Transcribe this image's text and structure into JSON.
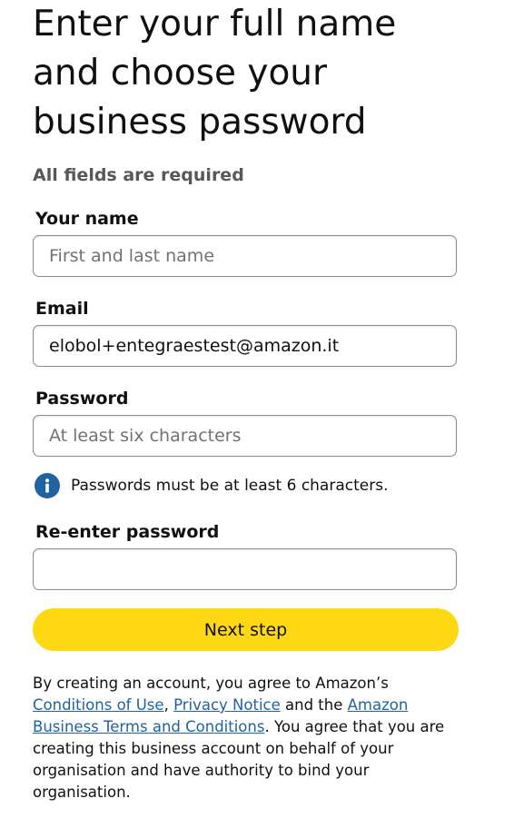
{
  "heading": {
    "line1": "Enter your full name",
    "line2": "and choose your",
    "line3": "business password"
  },
  "subtitle": "All fields are required",
  "fields": {
    "name": {
      "label": "Your name",
      "placeholder": "First and last name",
      "value": ""
    },
    "email": {
      "label": "Email",
      "placeholder": "",
      "value": "elobol+entegraestest@amazon.it"
    },
    "password": {
      "label": "Password",
      "placeholder": "At least six characters",
      "value": ""
    },
    "reenter": {
      "label": "Re-enter password",
      "placeholder": "",
      "value": ""
    }
  },
  "hint": {
    "icon": "info-icon",
    "text": "Passwords must be at least 6 characters."
  },
  "next_button": "Next step",
  "legal": {
    "intro": "By creating an account, you agree to Amazon’s",
    "conditions_link": "Conditions of Use",
    "comma": ",",
    "privacy_link": "Privacy Notice",
    "and_the": "and the",
    "terms_link": "Amazon Business Terms and Conditions",
    "outro": ". You agree that you are creating this business account on behalf of your organisation and have authority to bind your organisation."
  },
  "colors": {
    "button": "#ffd814",
    "link": "#2162a1",
    "info_icon": "#2162a1",
    "subtitle": "#565959",
    "input_border": "#888c8c"
  }
}
